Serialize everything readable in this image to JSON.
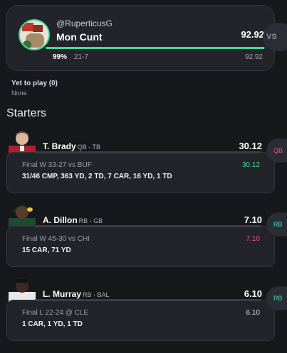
{
  "team": {
    "handle": "@RuperticusG",
    "name": "Mon Cunt",
    "score": "92.92",
    "win_pct": "99%",
    "win_pct_value": 0.99,
    "record": "21-7",
    "projected": "92.92",
    "vs_label": "VS",
    "colors": {
      "accent": "#3ddc97"
    }
  },
  "yet_to_play": {
    "label": "Yet to play (0)",
    "value": "None"
  },
  "starters": {
    "title": "Starters",
    "players": [
      {
        "name": "T. Brady",
        "pos_team": "QB - TB",
        "score": "30.12",
        "game": "Final W 33-27 vs BUF",
        "game_pts": "30.12",
        "game_pts_color": "#3ddc97",
        "stats": "31/46 CMP, 363 YD, 2 TD, 7 CAR, 16 YD, 1 TD",
        "badge": "QB",
        "badge_color": "#e8547a",
        "avatar_icon": "player-headshot-brady"
      },
      {
        "name": "A. Dillon",
        "pos_team": "RB - GB",
        "score": "7.10",
        "game": "Final W 45-30 vs CHI",
        "game_pts": "7.10",
        "game_pts_color": "#e8547a",
        "stats": "15 CAR, 71 YD",
        "badge": "RB",
        "badge_color": "#3ddcc0",
        "avatar_icon": "player-headshot-dillon"
      },
      {
        "name": "L. Murray",
        "pos_team": "RB - BAL",
        "score": "6.10",
        "game": "Final L 22-24 @ CLE",
        "game_pts": "6.10",
        "game_pts_color": "#d9dce2",
        "stats": "1 CAR, 1 YD, 1 TD",
        "badge": "RB",
        "badge_color": "#3ddcc0",
        "avatar_icon": "player-headshot-murray"
      }
    ]
  }
}
